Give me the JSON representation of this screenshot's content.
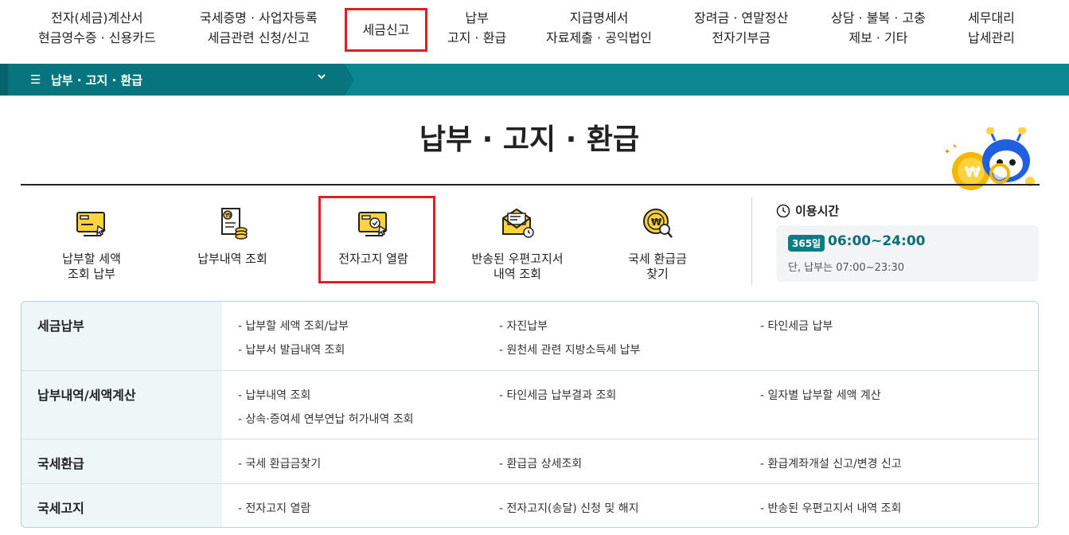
{
  "topnav": {
    "items": [
      {
        "line1": "전자(세금)계산서",
        "line2": "현금영수증 · 신용카드"
      },
      {
        "line1": "국세증명 · 사업자등록",
        "line2": "세금관련 신청/신고"
      },
      {
        "line1": "세금신고",
        "line2": ""
      },
      {
        "line1": "납부",
        "line2": "고지 · 환급"
      },
      {
        "line1": "지급명세서",
        "line2": "자료제출 · 공익법인"
      },
      {
        "line1": "장려금 · 연말정산",
        "line2": "전자기부금"
      },
      {
        "line1": "상담 · 불복 · 고충",
        "line2": "제보 · 기타"
      },
      {
        "line1": "세무대리",
        "line2": "납세관리"
      }
    ]
  },
  "menubar": {
    "label": "납부 · 고지 · 환급"
  },
  "page": {
    "title": "납부 · 고지 · 환급"
  },
  "quickmenu": {
    "items": [
      {
        "label": "납부할 세액\n조회 납부"
      },
      {
        "label": "납부내역 조회"
      },
      {
        "label": "전자고지 열람"
      },
      {
        "label": "반송된 우편고지서\n내역 조회"
      },
      {
        "label": "국세 환급금\n찾기"
      }
    ]
  },
  "hours": {
    "title": "이용시간",
    "badge": "365일",
    "time": "06:00~24:00",
    "note": "단, 납부는 07:00~23:30"
  },
  "services": {
    "rows": [
      {
        "category": "세금납부",
        "links": [
          "- 납부할 세액 조회/납부",
          "- 자진납부",
          "- 타인세금 납부",
          "- 납부서 발급내역 조회",
          "- 원천세 관련 지방소득세 납부"
        ]
      },
      {
        "category": "납부내역/세액계산",
        "links": [
          "- 납부내역 조회",
          "- 타인세금 납부결과 조회",
          "- 일자별 납부할 세액 계산",
          "- 상속·증여세 연부연납 허가내역 조회"
        ]
      },
      {
        "category": "국세환급",
        "links": [
          "- 국세 환급금찾기",
          "- 환급금 상세조회",
          "- 환급계좌개설 신고/변경 신고"
        ]
      },
      {
        "category": "국세고지",
        "links": [
          "- 전자고지 열람",
          "- 전자고지(송달) 신청 및 해지",
          "- 반송된 우편고지서 내역 조회"
        ]
      }
    ]
  },
  "colors": {
    "accent": "#0a8791",
    "highlight_border": "#e02020",
    "icon_yellow": "#f5c518"
  }
}
